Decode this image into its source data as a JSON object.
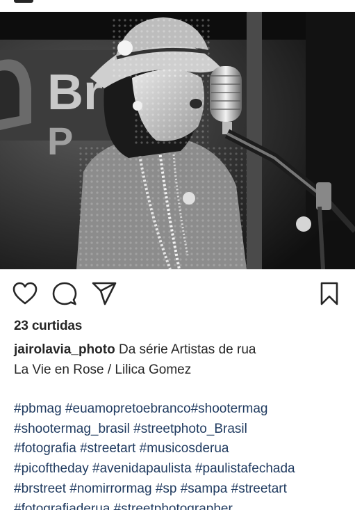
{
  "post": {
    "likes_text": "23 curtidas",
    "username": "jairolavia_photo",
    "caption_line1": "Da série Artistas de rua",
    "caption_line2": "La Vie en Rose / Lilica Gomez",
    "hashtag_rows": [
      [
        "#pbmag",
        "#euamopretoebranco#shootermag"
      ],
      [
        "#shootermag_brasil",
        "#streetphoto_Brasil"
      ],
      [
        "#fotografia",
        "#streetart",
        "#musicosderua"
      ],
      [
        "#picoftheday",
        "#avenidapaulista",
        "#paulistafechada"
      ],
      [
        "#brstreet",
        "#nomirrormag",
        "#sp",
        "#sampa",
        "#streetart"
      ],
      [
        "#fotografiaderua",
        "#streetphotographer"
      ]
    ]
  },
  "photo": {
    "background_sign_text": "Br",
    "background_sign_text2": "P"
  },
  "actions": {
    "like_icon": "heart-icon",
    "comment_icon": "comment-bubble-icon",
    "share_icon": "paper-plane-icon",
    "save_icon": "bookmark-icon"
  },
  "colors": {
    "text": "#262626",
    "hashtag": "#1f3a5f",
    "background": "#ffffff"
  }
}
